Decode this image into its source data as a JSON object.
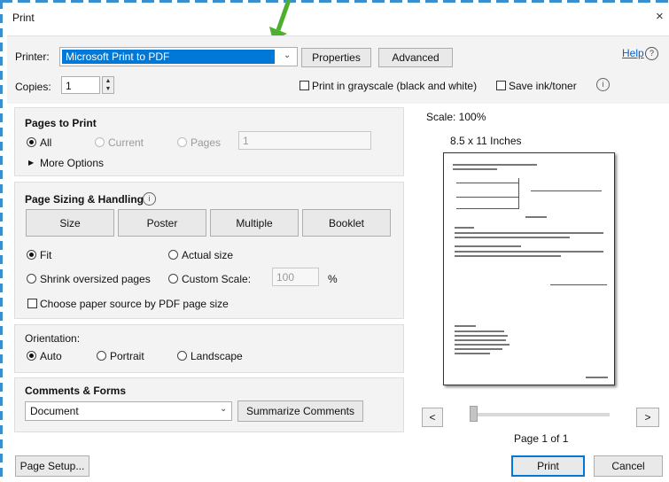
{
  "dialog": {
    "title": "Print",
    "close_glyph": "×"
  },
  "printer": {
    "label": "Printer:",
    "value": "Microsoft Print to PDF",
    "properties": "Properties",
    "advanced": "Advanced",
    "help": "Help"
  },
  "copies": {
    "label": "Copies:",
    "value": "1",
    "grayscale": "Print in grayscale (black and white)",
    "save_ink": "Save ink/toner"
  },
  "pages": {
    "heading": "Pages to Print",
    "all": "All",
    "current": "Current",
    "pages": "Pages",
    "range": "1",
    "more_options": "More Options",
    "selected": "All"
  },
  "sizing": {
    "heading": "Page Sizing & Handling",
    "tabs": [
      "Size",
      "Poster",
      "Multiple",
      "Booklet"
    ],
    "fit": "Fit",
    "actual": "Actual size",
    "shrink": "Shrink oversized pages",
    "custom": "Custom Scale:",
    "scale": "100",
    "pct": "%",
    "paper_source": "Choose paper source by PDF page size",
    "selected": "Fit"
  },
  "orientation": {
    "heading": "Orientation:",
    "auto": "Auto",
    "portrait": "Portrait",
    "landscape": "Landscape",
    "selected": "Auto"
  },
  "comments": {
    "heading": "Comments & Forms",
    "value": "Document",
    "summarize": "Summarize Comments"
  },
  "preview": {
    "scale": "Scale: 100%",
    "paper": "8.5 x 11 Inches",
    "prev": "<",
    "next": ">",
    "page_label": "Page 1 of 1",
    "slider_position": 0
  },
  "footer": {
    "page_setup": "Page Setup...",
    "print": "Print",
    "cancel": "Cancel"
  },
  "colors": {
    "accent": "#0078d7",
    "arrow": "#4caf2f",
    "dash": "#3a8fd0"
  }
}
